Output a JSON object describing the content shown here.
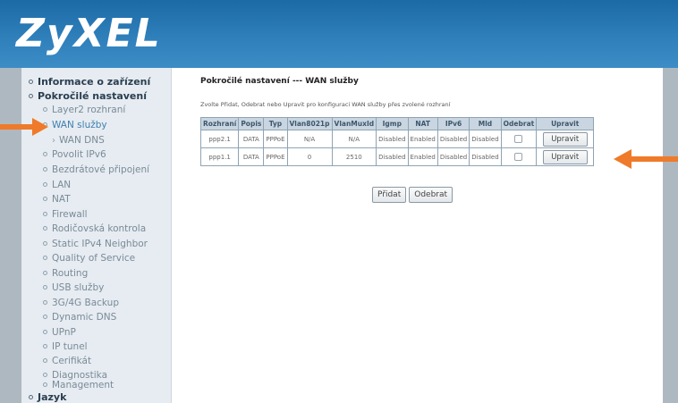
{
  "brand": {
    "logo": "ZyXEL"
  },
  "sidebar": {
    "items": [
      {
        "label": "Informace o zařízení",
        "level": "top"
      },
      {
        "label": "Pokročilé nastavení",
        "level": "top"
      },
      {
        "label": "Layer2 rozhraní",
        "level": "sub"
      },
      {
        "label": "WAN služby",
        "level": "sub",
        "active": true
      },
      {
        "label": "WAN DNS",
        "level": "subsub"
      },
      {
        "label": "Povolit IPv6",
        "level": "sub"
      },
      {
        "label": "Bezdrátové připojení",
        "level": "sub"
      },
      {
        "label": "LAN",
        "level": "sub"
      },
      {
        "label": "NAT",
        "level": "sub"
      },
      {
        "label": "Firewall",
        "level": "sub"
      },
      {
        "label": "Rodičovská kontrola",
        "level": "sub"
      },
      {
        "label": "Static IPv4 Neighbor",
        "level": "sub"
      },
      {
        "label": "Quality of Service",
        "level": "sub"
      },
      {
        "label": "Routing",
        "level": "sub"
      },
      {
        "label": "USB služby",
        "level": "sub"
      },
      {
        "label": "3G/4G Backup",
        "level": "sub"
      },
      {
        "label": "Dynamic DNS",
        "level": "sub"
      },
      {
        "label": "UPnP",
        "level": "sub"
      },
      {
        "label": "IP tunel",
        "level": "sub"
      },
      {
        "label": "Cerifikát",
        "level": "sub"
      },
      {
        "label": "Diagnostika",
        "level": "sub"
      },
      {
        "label": "Management",
        "level": "sub"
      },
      {
        "label": "Jazyk",
        "level": "top"
      }
    ]
  },
  "main": {
    "title": "Pokročilé nastavení --- WAN služby",
    "instruction": "Zvolte Přidat, Odebrat nebo Upravit pro konfiguraci WAN služby přes zvolené rozhraní",
    "table": {
      "headers": [
        "Rozhraní",
        "Popis",
        "Typ",
        "Vlan8021p",
        "VlanMuxId",
        "Igmp",
        "NAT",
        "IPv6",
        "Mld",
        "Odebrat",
        "Upravit"
      ],
      "rows": [
        {
          "iface": "ppp2.1",
          "popis": "DATA",
          "typ": "PPPoE",
          "vlan8021p": "N/A",
          "vlanmuxid": "N/A",
          "igmp": "Disabled",
          "nat": "Enabled",
          "ipv6": "Disabled",
          "mld": "Disabled",
          "remove_checked": false,
          "edit_label": "Upravit"
        },
        {
          "iface": "ppp1.1",
          "popis": "DATA",
          "typ": "PPPoE",
          "vlan8021p": "0",
          "vlanmuxid": "2510",
          "igmp": "Disabled",
          "nat": "Enabled",
          "ipv6": "Disabled",
          "mld": "Disabled",
          "remove_checked": false,
          "edit_label": "Upravit"
        }
      ]
    },
    "add_label": "Přidat",
    "remove_label": "Odebrat"
  },
  "colors": {
    "header": "#2f7fbb",
    "arrow": "#ef7a2a",
    "sidebar_bg": "#e6ecf1",
    "table_header_bg": "#c9d6e1",
    "active_link": "#3f7fb0"
  }
}
